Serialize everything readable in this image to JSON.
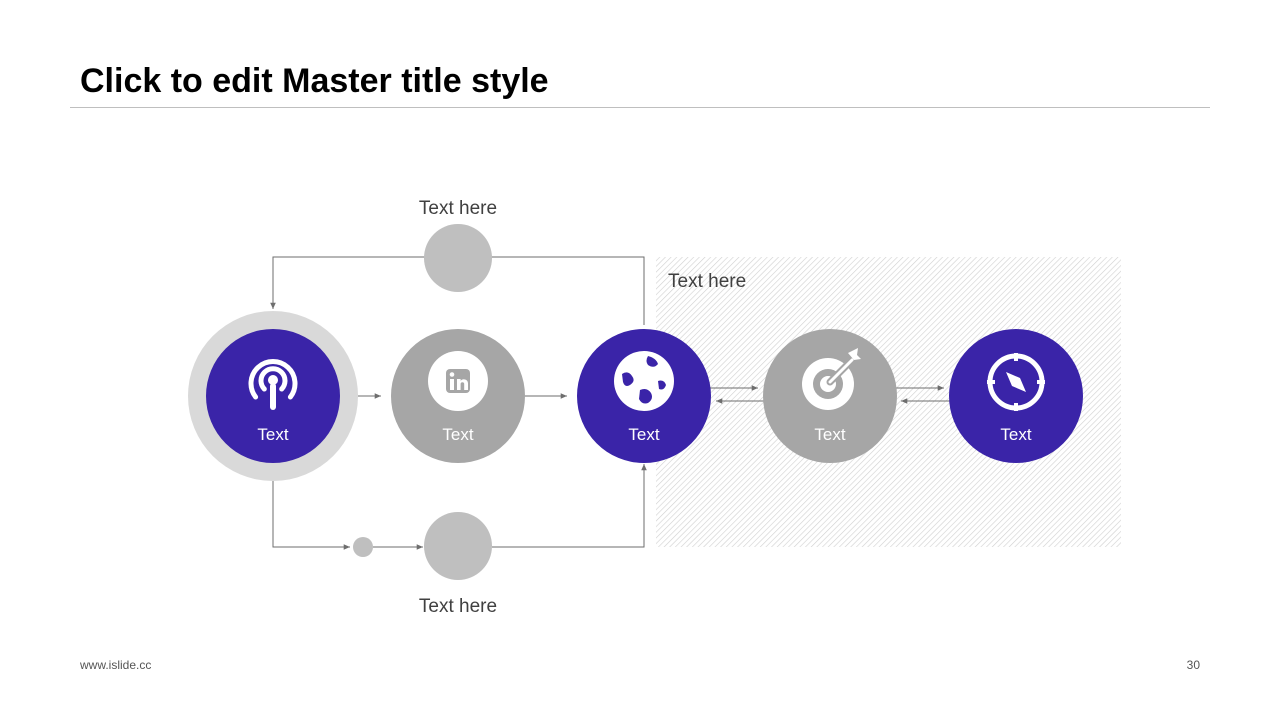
{
  "slide": {
    "title": "Click to edit Master title style",
    "footer_url": "www.islide.cc",
    "page_number": "30"
  },
  "diagram": {
    "top_label": "Text here",
    "bottom_label": "Text here",
    "region_label": "Text here",
    "nodes": [
      {
        "label": "Text",
        "icon": "podcast-icon"
      },
      {
        "label": "Text",
        "icon": "linkedin-icon"
      },
      {
        "label": "Text",
        "icon": "globe-icon"
      },
      {
        "label": "Text",
        "icon": "target-icon"
      },
      {
        "label": "Text",
        "icon": "compass-icon"
      }
    ]
  },
  "colors": {
    "accent": "#3A24A8",
    "gray_node": "#A6A6A6",
    "light_circle": "#BFBFBF",
    "ring": "#D9D9D9",
    "connector": "#6E6E6E"
  }
}
